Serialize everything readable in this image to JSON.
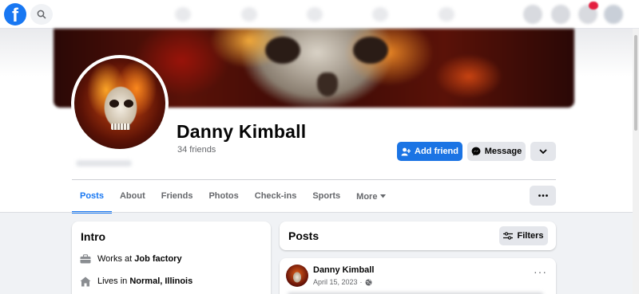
{
  "app": {
    "name": "Facebook",
    "logo_glyph": "f",
    "brand_color": "#1877f2"
  },
  "profile": {
    "name": "Danny Kimball",
    "friends": "34 friends",
    "add_friend_label": "Add friend",
    "message_label": "Message"
  },
  "tabs": [
    {
      "label": "Posts"
    },
    {
      "label": "About"
    },
    {
      "label": "Friends"
    },
    {
      "label": "Photos"
    },
    {
      "label": "Check-ins"
    },
    {
      "label": "Sports"
    },
    {
      "label": "More"
    }
  ],
  "intro": {
    "title": "Intro",
    "works_prefix": "Works at ",
    "works_value": "Job factory",
    "lives_prefix": "Lives in ",
    "lives_value": "Normal, Illinois"
  },
  "posts": {
    "title": "Posts",
    "filters_label": "Filters"
  },
  "post": {
    "author": "Danny Kimball",
    "date": "April 15, 2023",
    "separator": "·",
    "menu_glyph": "···"
  },
  "icons": {
    "search": "search-icon",
    "add_friend": "add-person-icon",
    "message": "messenger-icon",
    "chevron": "chevron-down-icon",
    "more": "more-horizontal-icon",
    "filters": "filters-icon",
    "work": "briefcase-icon",
    "home": "home-icon",
    "globe": "globe-icon"
  }
}
